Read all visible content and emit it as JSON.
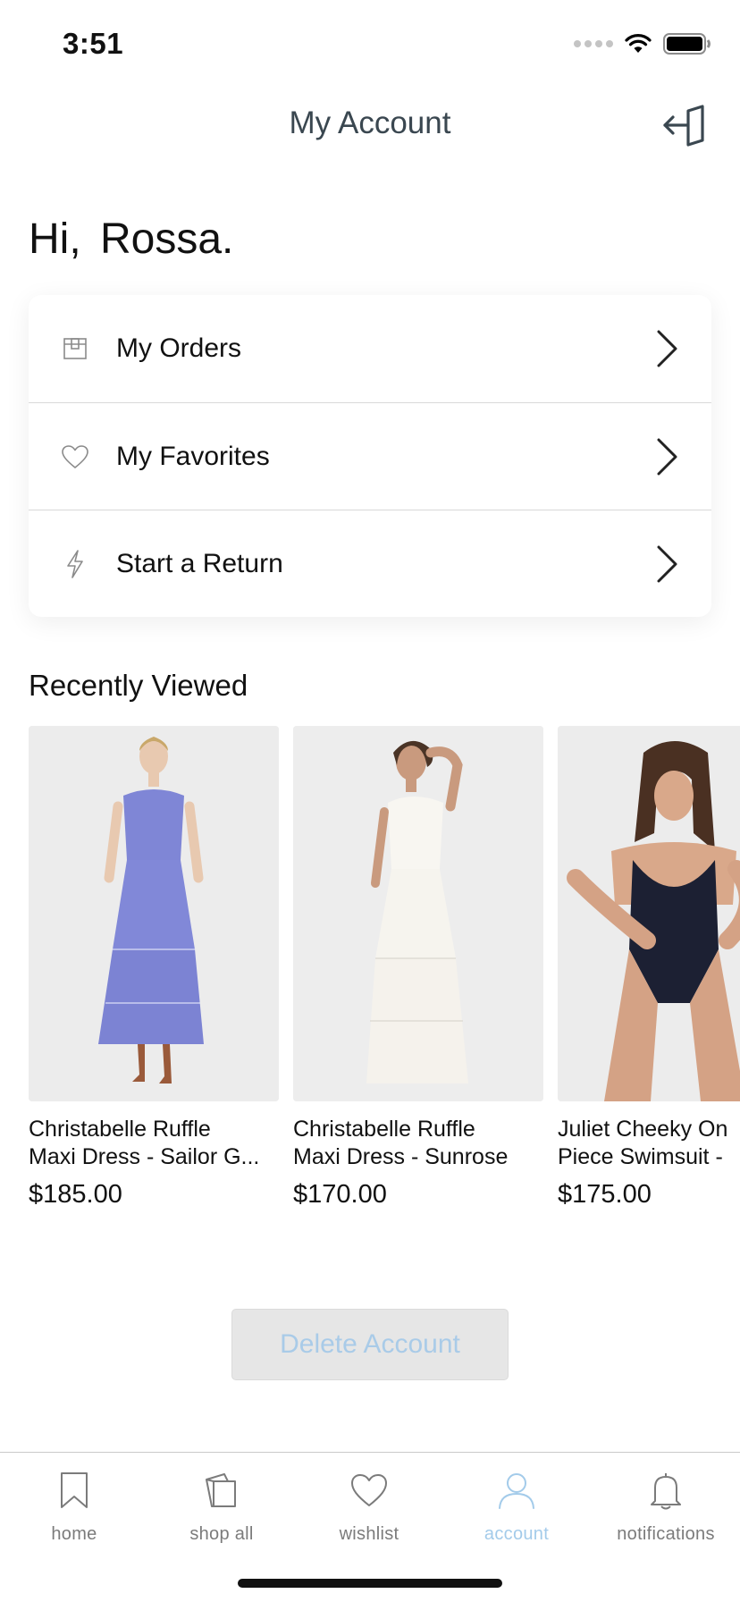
{
  "status_bar": {
    "time": "3:51"
  },
  "header": {
    "title": "My Account"
  },
  "greeting": "Hi,  Rossa.",
  "menu": [
    {
      "label": "My Orders",
      "icon": "box-icon"
    },
    {
      "label": "My Favorites",
      "icon": "heart-icon"
    },
    {
      "label": "Start a Return",
      "icon": "lightning-icon"
    }
  ],
  "recently_viewed": {
    "title": "Recently Viewed",
    "products": [
      {
        "name_line1": "Christabelle Ruffle",
        "name_line2": "Maxi Dress - Sailor G...",
        "price": "$185.00",
        "color": "#7f86d6"
      },
      {
        "name_line1": "Christabelle Ruffle",
        "name_line2": "Maxi Dress - Sunrose",
        "price": "$170.00",
        "color": "#f7f5f0"
      },
      {
        "name_line1": "Juliet Cheeky On",
        "name_line2": "Piece Swimsuit -",
        "price": "$175.00",
        "color": "#1c2033"
      }
    ]
  },
  "delete_account": {
    "label": "Delete Account"
  },
  "tab_bar": {
    "tabs": [
      {
        "label": "home",
        "icon": "bookmark-icon",
        "active": false
      },
      {
        "label": "shop all",
        "icon": "shopping-bag-icon",
        "active": false
      },
      {
        "label": "wishlist",
        "icon": "heart-icon",
        "active": false
      },
      {
        "label": "account",
        "icon": "user-icon",
        "active": true
      },
      {
        "label": "notifications",
        "icon": "bell-icon",
        "active": false
      }
    ]
  },
  "colors": {
    "accent": "#a3cbea",
    "tab_inactive": "#7b7b7b",
    "header_text": "#3a4750"
  }
}
